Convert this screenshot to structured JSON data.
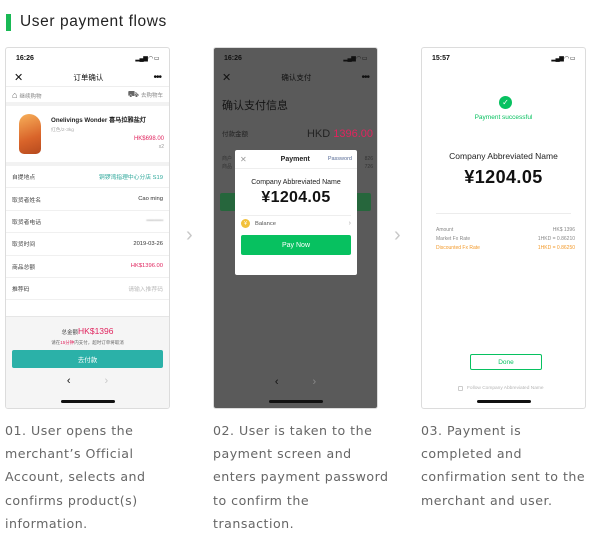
{
  "heading": {
    "title": "User payment flows",
    "accent_color": "#19b955"
  },
  "screen1": {
    "time": "16:26",
    "title": "订单确认",
    "close_icon": "close-icon",
    "more_icon": "more-icon",
    "tab_left": "继续购物",
    "tab_right": "去购物车",
    "product_name": "Onelivings Wonder 喜马拉雅盐灯",
    "product_sub": "红色/2-3kg",
    "product_price": "HK$698.00",
    "product_qty": "x2",
    "rows": [
      {
        "label": "自提地点",
        "value": "铜锣湾指理中心分店 S19"
      },
      {
        "label": "取货者姓名",
        "value": "Cao ming"
      },
      {
        "label": "取货者电话",
        "value": "•••••••••••"
      },
      {
        "label": "取货时间",
        "value": "2019-03-26"
      },
      {
        "label": "商品总额",
        "value": "HK$1396.00"
      },
      {
        "label": "推荐码",
        "value": "请输入推荐码"
      }
    ],
    "total_label": "总金额",
    "total_value": "HK$1396",
    "tip_pre": "请在",
    "tip_highlight": "15分钟",
    "tip_post": "内支付，超时订单将取消",
    "pay_button": "去付款",
    "back_arrow": "‹",
    "forward_arrow": "›"
  },
  "screen2": {
    "time": "16:26",
    "title": "确认支付",
    "page_title": "确认支付信息",
    "amount_label": "付款金额",
    "amount_currency": "HKD ",
    "amount_value": "1396.00",
    "faint_left": "商户\n商品",
    "faint_right": "826\n726",
    "modal_title": "Payment",
    "modal_password": "Password",
    "modal_company": "Company Abbreviated Name",
    "modal_amount": "¥1204.05",
    "balance_label": "Balance",
    "pay_now": "Pay Now",
    "back_arrow": "‹",
    "forward_arrow": "›"
  },
  "screen3": {
    "time": "15:57",
    "success": "Payment successful",
    "company": "Company Abbreviated Name",
    "amount": "¥1204.05",
    "rows": [
      {
        "label": "Amount",
        "value": "HK$ 1396",
        "highlight": false
      },
      {
        "label": "Market Fx Rate",
        "value": "1HKD = 0.86210",
        "highlight": false
      },
      {
        "label": "Discounted Fx Rate",
        "value": "1HKD = 0.86250",
        "highlight": true
      }
    ],
    "done": "Done",
    "follow": "Follow Company Abbreviated Name"
  },
  "captions": [
    "01. User opens the merchant’s Official Account, selects and confirms product(s) information.",
    "02. User is taken to the payment screen and enters payment password to confirm the transaction.",
    "03. Payment is completed and confirmation sent to the merchant and user."
  ],
  "step_arrow": "›"
}
